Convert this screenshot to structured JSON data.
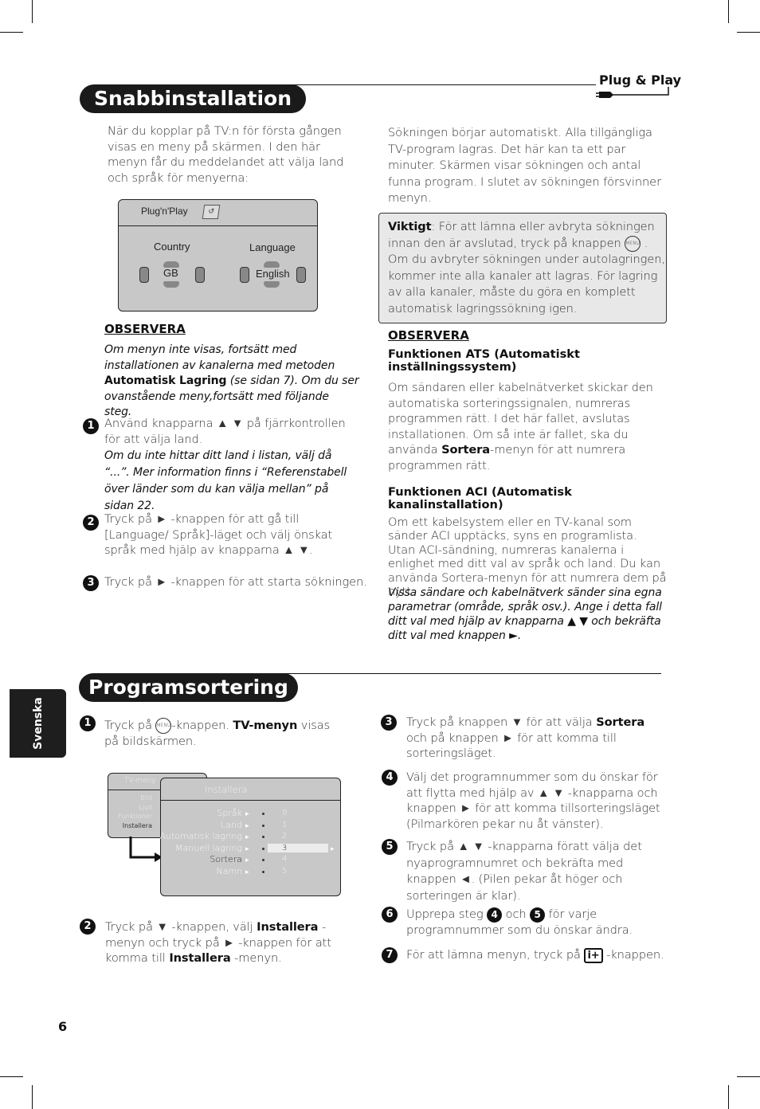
{
  "header": {
    "logo_text": "Plug & Play"
  },
  "section1": {
    "title": "Snabbinstallation",
    "intro": "När du kopplar på TV:n för första gången visas en meny på skärmen. I den här menyn får du meddelandet att välja land och språk för menyerna:",
    "screen": {
      "title": "Plug'n'Play",
      "country_label": "Country",
      "country_value": "GB",
      "language_label": "Language",
      "language_value": "English"
    },
    "note_heading": "OBSERVERA",
    "note_part1": "Om menyn inte visas, fortsätt med installationen av kanalerna med metoden ",
    "note_bold": "Automatisk Lagring",
    "note_part2": " (se sidan 7). Om du ser ovanstående meny,fortsätt med följande steg.",
    "steps": [
      {
        "num": "1",
        "text": "Använd knapparna ▲ ▼ på fjärrkontrollen för att välja land.",
        "italic": "Om du inte hittar ditt land i listan, välj då “...”. Mer information finns i “Referenstabell över länder som du kan välja mellan” på sidan 22."
      },
      {
        "num": "2",
        "text": "Tryck på ► -knappen för att gå till [Language/ Språk]-läget och välj önskat språk med hjälp av knapparna ▲ ▼."
      },
      {
        "num": "3",
        "text": "Tryck på ► -knappen för att starta sökningen."
      }
    ],
    "right_intro": "Sökningen börjar automatiskt. Alla tillgängliga TV-program lagras. Det här kan ta ett par minuter. Skärmen visar sökningen och antal funna program. I slutet av sökningen försvinner menyn.",
    "important_label": "Viktigt",
    "important_part1": ": För att lämna eller avbryta sökningen innan den är avslutad, tryck på knappen ",
    "menu_icon_label": "MENU",
    "important_part2": " . Om du avbryter sökningen under autolagringen, kommer inte alla kanaler att lagras. För lagring av alla kanaler, måste du göra en komplett automatisk lagringssökning igen.",
    "note2_heading": "OBSERVERA",
    "ats_heading": "Funktionen ATS (Automatiskt inställningssystem)",
    "ats_part1": "Om sändaren eller kabelnätverket skickar den automatiska sorteringssignalen, numreras programmen rätt. I det här fallet, avslutas installationen. Om så inte är fallet, ska du använda ",
    "ats_bold": "Sortera",
    "ats_part2": "-menyn för att numrera programmen rätt.",
    "aci_heading": "Funktionen ACI (Automatisk kanalinstallation)",
    "aci_text": "Om ett kabelsystem eller en TV-kanal som sänder ACI upptäcks, syns en programlista. Utan ACI-sändning, numreras kanalerna i enlighet med ditt val av språk och land. Du kan använda Sortera-menyn för att numrera dem på nytt.",
    "aci_italic": "Vissa sändare och kabelnätverk sänder sina egna parametrar (område, språk osv.). Ange i detta fall ditt val med hjälp av knapparna ▲ ▼ och bekräfta ditt val med knappen ►."
  },
  "section2": {
    "title": "Programsortering",
    "side_tab": "Svenska",
    "step1_part1": "Tryck på ",
    "step1_part2": "-knappen. ",
    "step1_bold": "TV-menyn",
    "step1_part3": " visas på bildskärmen.",
    "tv_menu": {
      "title": "TV-meny",
      "items": [
        "Bild",
        "Ljud",
        "Funktioner",
        "Installera"
      ]
    },
    "install_menu": {
      "title": "Installera",
      "items": [
        "Språk",
        "Land",
        "Automatisk lagring",
        "Manuell lagring",
        "Sortera",
        "Namn"
      ],
      "numbers": [
        "0",
        "1",
        "2",
        "3",
        "4",
        "5"
      ],
      "highlighted_number": "3"
    },
    "step2_part1": "Tryck på ▼ -knappen, välj ",
    "step2_bold1": "Installera",
    "step2_part2": " -menyn och tryck på ► -knappen för att komma till ",
    "step2_bold2": "Installera",
    "step2_part3": " -menyn.",
    "step3_part1": "Tryck på knappen ▼ för att välja ",
    "step3_bold": "Sortera",
    "step3_part2": " och på knappen ► för att komma till sorteringsläget.",
    "step4": "Välj det programnummer som du önskar för att flytta med hjälp av ▲ ▼ -knapparna och knappen ► för att komma tillsorteringsläget (Pilmarkören pekar nu åt vänster).",
    "step5": "Tryck på ▲ ▼ -knapparna föratt välja det nyaprogramnumret och bekräfta med knappen ◄. (Pilen pekar åt höger och sorteringen är klar).",
    "step6_part1": "Upprepa steg ",
    "step6_ref1": "4",
    "step6_mid": " och ",
    "step6_ref2": "5",
    "step6_part2": " för varje programnummer som du önskar ändra.",
    "step7_part1": "För att lämna menyn, tryck på ",
    "step7_button": "i+",
    "step7_part2": " -knappen.",
    "step_nums": [
      "1",
      "2",
      "3",
      "4",
      "5",
      "6",
      "7"
    ]
  },
  "footer": {
    "page_number": "6"
  }
}
